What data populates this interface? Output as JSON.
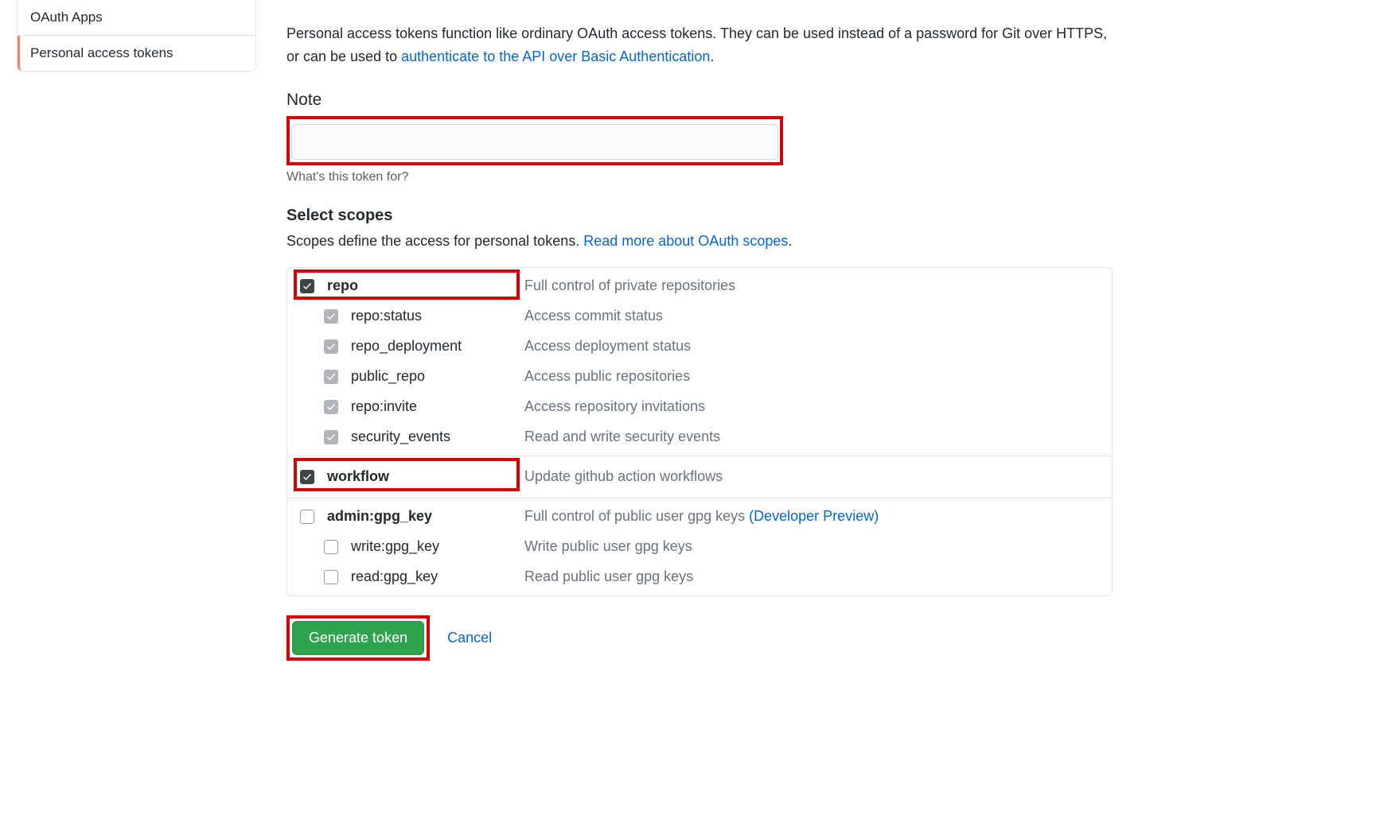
{
  "sidebar": {
    "items": [
      {
        "label": "OAuth Apps",
        "selected": false
      },
      {
        "label": "Personal access tokens",
        "selected": true
      }
    ]
  },
  "intro": {
    "text_before_link": "Personal access tokens function like ordinary OAuth access tokens. They can be used instead of a password for Git over HTTPS, or can be used to ",
    "link_text": "authenticate to the API over Basic Authentication",
    "text_after_link": "."
  },
  "note": {
    "label": "Note",
    "value": "",
    "hint": "What's this token for?"
  },
  "scopes": {
    "heading": "Select scopes",
    "desc_before_link": "Scopes define the access for personal tokens. ",
    "link_text": "Read more about OAuth scopes",
    "desc_after_link": ".",
    "groups": [
      {
        "name": "repo",
        "desc": "Full control of private repositories",
        "checked": true,
        "highlighted": true,
        "children": [
          {
            "name": "repo:status",
            "desc": "Access commit status",
            "checked": true,
            "disabled": true
          },
          {
            "name": "repo_deployment",
            "desc": "Access deployment status",
            "checked": true,
            "disabled": true
          },
          {
            "name": "public_repo",
            "desc": "Access public repositories",
            "checked": true,
            "disabled": true
          },
          {
            "name": "repo:invite",
            "desc": "Access repository invitations",
            "checked": true,
            "disabled": true
          },
          {
            "name": "security_events",
            "desc": "Read and write security events",
            "checked": true,
            "disabled": true
          }
        ]
      },
      {
        "name": "workflow",
        "desc": "Update github action workflows",
        "checked": true,
        "highlighted": true,
        "children": []
      },
      {
        "name": "admin:gpg_key",
        "desc": "Full control of public user gpg keys ",
        "desc_link": "(Developer Preview)",
        "checked": false,
        "highlighted": false,
        "children": [
          {
            "name": "write:gpg_key",
            "desc": "Write public user gpg keys",
            "checked": false,
            "disabled": false
          },
          {
            "name": "read:gpg_key",
            "desc": "Read public user gpg keys",
            "checked": false,
            "disabled": false
          }
        ]
      }
    ]
  },
  "actions": {
    "generate_label": "Generate token",
    "cancel_label": "Cancel"
  }
}
